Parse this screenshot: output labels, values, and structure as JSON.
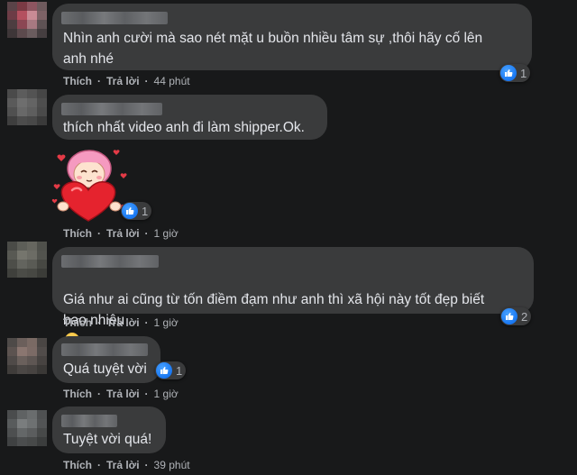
{
  "comments": [
    {
      "text": "Nhìn anh cười mà sao nét mặt u buồn nhiều tâm sự ,thôi hãy cố lên\nanh nhé",
      "like_label": "Thích",
      "reply_label": "Trả lời",
      "time": "44 phút",
      "reaction_count": "1"
    },
    {
      "text": "thích nhất video anh đi làm shipper.Ok.",
      "sticker": "heart-hug-girl-sticker",
      "like_label": "Thích",
      "reply_label": "Trả lời",
      "time": "1 giờ",
      "reaction_count": "1"
    },
    {
      "text": "Giá như ai cũng từ tốn điềm đạm như anh thì xã hội này tốt đẹp biết\nbao nhiêu",
      "emoji": "pensive-face-emoji",
      "like_label": "Thích",
      "reply_label": "Trả lời",
      "time": "1 giờ",
      "reaction_count": "2"
    },
    {
      "text": "Quá tuyệt vời",
      "like_label": "Thích",
      "reply_label": "Trả lời",
      "time": "1 giờ",
      "reaction_count": "1"
    },
    {
      "text": "Tuyệt vời quá!",
      "like_label": "Thích",
      "reply_label": "Trả lời",
      "time": "39 phút"
    }
  ],
  "colors": {
    "background": "#18191a",
    "bubble": "#3a3b3c",
    "text": "#e4e6eb",
    "secondary_text": "#b0b3b8",
    "like_blue": "#1877f2"
  }
}
